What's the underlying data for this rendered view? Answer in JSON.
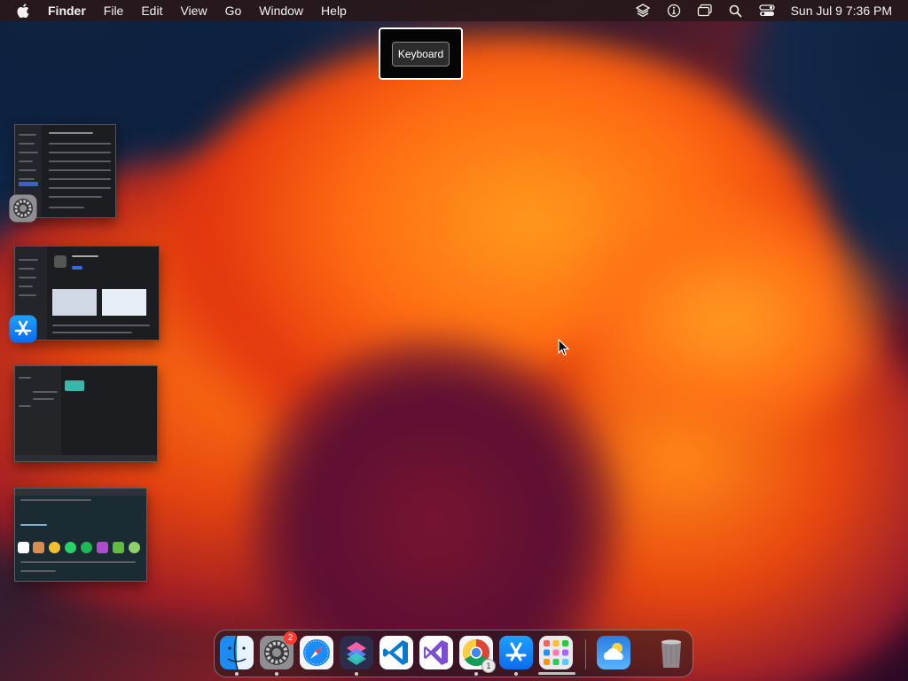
{
  "menubar": {
    "app_name": "Finder",
    "items": [
      "File",
      "Edit",
      "View",
      "Go",
      "Window",
      "Help"
    ],
    "status_icons": [
      "layers-icon",
      "accessibility-icon",
      "screen-mirroring-icon",
      "spotlight-search-icon",
      "control-center-icon"
    ],
    "clock": "Sun Jul 9  7:36 PM"
  },
  "hud": {
    "label": "Keyboard"
  },
  "stage_manager": {
    "windows": [
      {
        "app": "System Settings",
        "icon": "settings-icon"
      },
      {
        "app": "App Store",
        "icon": "app-store-icon"
      },
      {
        "app": "Dark editor window",
        "icon": "none"
      },
      {
        "app": "Browser window",
        "icon": "none"
      }
    ]
  },
  "dock": {
    "items": [
      {
        "name": "Finder",
        "icon": "finder-icon",
        "running": true
      },
      {
        "name": "System Settings",
        "icon": "settings-icon",
        "running": true,
        "badge": "2"
      },
      {
        "name": "Safari",
        "icon": "safari-icon",
        "running": false
      },
      {
        "name": "Shortcuts",
        "icon": "shortcuts-icon",
        "running": true
      },
      {
        "name": "Visual Studio Code",
        "icon": "vscode-icon",
        "running": false
      },
      {
        "name": "Visual Studio",
        "icon": "visual-studio-icon",
        "running": false
      },
      {
        "name": "Google Chrome",
        "icon": "chrome-icon",
        "running": true,
        "badge": "1"
      },
      {
        "name": "App Store",
        "icon": "app-store-icon",
        "running": true
      },
      {
        "name": "Launchpad",
        "icon": "launchpad-icon",
        "running": false
      },
      {
        "name": "Weather",
        "icon": "weather-icon",
        "running": false
      },
      {
        "name": "Trash",
        "icon": "trash-icon",
        "running": false
      }
    ]
  }
}
